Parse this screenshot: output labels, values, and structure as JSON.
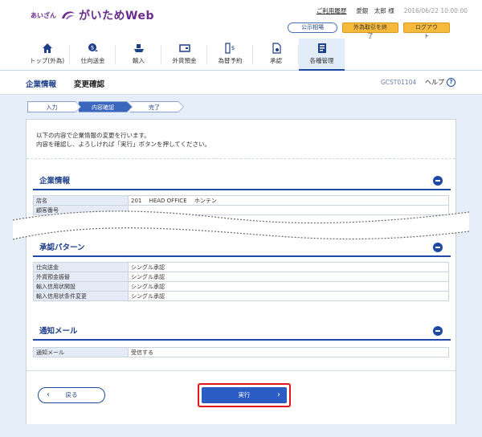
{
  "header": {
    "brand_prefix": "あいざん",
    "brand_name": "がいためWeb",
    "links": {
      "history": "ご利用履歴",
      "user": "愛銀　太郎 様",
      "datetime": "2016/06/22 10:00:00"
    },
    "buttons": {
      "rates": "公示相場",
      "end_fx": "外為取引を終了",
      "logout": "ログアウト"
    },
    "nav": [
      {
        "label": "トップ(外為)",
        "icon": "home-icon"
      },
      {
        "label": "仕向送金",
        "icon": "remittance-icon"
      },
      {
        "label": "輸入",
        "icon": "import-ship-icon"
      },
      {
        "label": "外貨預金",
        "icon": "deposit-icon"
      },
      {
        "label": "為替予約",
        "icon": "fx-contract-icon"
      },
      {
        "label": "承認",
        "icon": "approval-icon"
      },
      {
        "label": "各種管理",
        "icon": "management-icon"
      }
    ]
  },
  "titlebar": {
    "section": "企業情報",
    "page": "変更確認",
    "screen_id": "GCST01104",
    "help": "ヘルプ"
  },
  "steps": [
    "入力",
    "内容確認",
    "完了"
  ],
  "intro": {
    "line1": "以下の内容で企業情報の変更を行います。",
    "line2": "内容を確認し、よろしければ「実行」ボタンを押してください。"
  },
  "company": {
    "title": "企業情報",
    "rows": [
      {
        "label": "店名",
        "value": "201　 HEAD OFFICE　 ホンテン"
      },
      {
        "label": "顧客番号",
        "value": ""
      }
    ]
  },
  "approval": {
    "title": "承認パターン",
    "rows": [
      {
        "label": "仕向送金",
        "value": "シングル承認"
      },
      {
        "label": "外貨預金振替",
        "value": "シングル承認"
      },
      {
        "label": "輸入信用状開設",
        "value": "シングル承認"
      },
      {
        "label": "輸入信用状条件変更",
        "value": "シングル承認"
      }
    ]
  },
  "notify": {
    "title": "通知メール",
    "rows": [
      {
        "label": "通知メール",
        "value": "受信する"
      }
    ]
  },
  "actions": {
    "back": "戻る",
    "execute": "実行"
  }
}
